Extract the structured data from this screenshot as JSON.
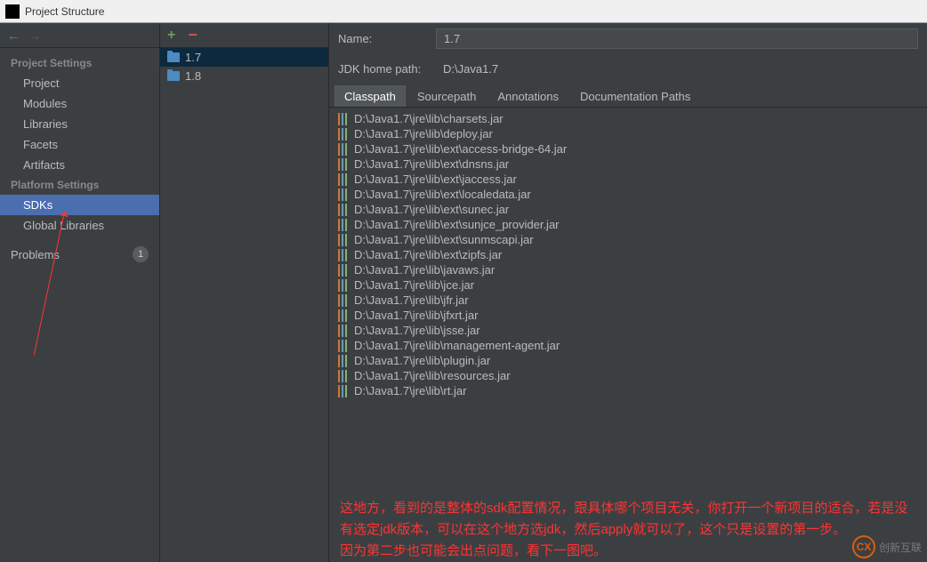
{
  "window": {
    "title": "Project Structure"
  },
  "leftPanel": {
    "projectSettingsHeader": "Project Settings",
    "projectItems": [
      "Project",
      "Modules",
      "Libraries",
      "Facets",
      "Artifacts"
    ],
    "platformSettingsHeader": "Platform Settings",
    "platformItems": [
      "SDKs",
      "Global Libraries"
    ],
    "problemsLabel": "Problems",
    "problemsCount": "1"
  },
  "middlePanel": {
    "sdks": [
      {
        "label": "1.7",
        "selected": true
      },
      {
        "label": "1.8",
        "selected": false
      }
    ]
  },
  "rightPanel": {
    "nameLabel": "Name:",
    "nameValue": "1.7",
    "jdkLabel": "JDK home path:",
    "jdkPath": "D:\\Java1.7",
    "tabs": [
      "Classpath",
      "Sourcepath",
      "Annotations",
      "Documentation Paths"
    ],
    "classpathEntries": [
      "D:\\Java1.7\\jre\\lib\\charsets.jar",
      "D:\\Java1.7\\jre\\lib\\deploy.jar",
      "D:\\Java1.7\\jre\\lib\\ext\\access-bridge-64.jar",
      "D:\\Java1.7\\jre\\lib\\ext\\dnsns.jar",
      "D:\\Java1.7\\jre\\lib\\ext\\jaccess.jar",
      "D:\\Java1.7\\jre\\lib\\ext\\localedata.jar",
      "D:\\Java1.7\\jre\\lib\\ext\\sunec.jar",
      "D:\\Java1.7\\jre\\lib\\ext\\sunjce_provider.jar",
      "D:\\Java1.7\\jre\\lib\\ext\\sunmscapi.jar",
      "D:\\Java1.7\\jre\\lib\\ext\\zipfs.jar",
      "D:\\Java1.7\\jre\\lib\\javaws.jar",
      "D:\\Java1.7\\jre\\lib\\jce.jar",
      "D:\\Java1.7\\jre\\lib\\jfr.jar",
      "D:\\Java1.7\\jre\\lib\\jfxrt.jar",
      "D:\\Java1.7\\jre\\lib\\jsse.jar",
      "D:\\Java1.7\\jre\\lib\\management-agent.jar",
      "D:\\Java1.7\\jre\\lib\\plugin.jar",
      "D:\\Java1.7\\jre\\lib\\resources.jar",
      "D:\\Java1.7\\jre\\lib\\rt.jar"
    ]
  },
  "annotation": {
    "line1": "这地方，看到的是整体的sdk配置情况，跟具体哪个项目无关，你打开一个新项目的适合，若是没有选定jdk版本，可以在这个地方选jdk，然后apply就可以了，这个只是设置的第一步。",
    "line2": "因为第二步也可能会出点问题，看下一图吧。"
  },
  "watermark": {
    "logo": "CX",
    "text": "创新互联"
  }
}
